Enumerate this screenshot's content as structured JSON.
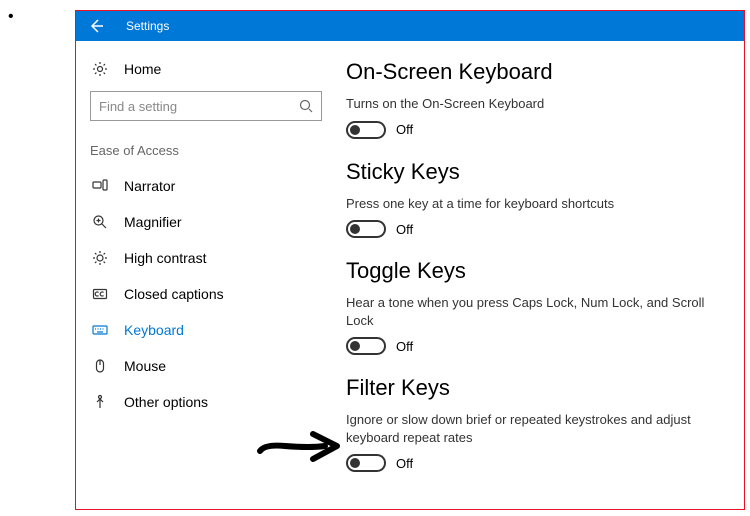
{
  "window": {
    "title": "Settings"
  },
  "sidebar": {
    "home": "Home",
    "search_placeholder": "Find a setting",
    "section_header": "Ease of Access",
    "items": [
      {
        "label": "Narrator"
      },
      {
        "label": "Magnifier"
      },
      {
        "label": "High contrast"
      },
      {
        "label": "Closed captions"
      },
      {
        "label": "Keyboard"
      },
      {
        "label": "Mouse"
      },
      {
        "label": "Other options"
      }
    ]
  },
  "main": {
    "groups": [
      {
        "title": "On-Screen Keyboard",
        "desc": "Turns on the On-Screen Keyboard",
        "state": "Off"
      },
      {
        "title": "Sticky Keys",
        "desc": "Press one key at a time for keyboard shortcuts",
        "state": "Off"
      },
      {
        "title": "Toggle Keys",
        "desc": "Hear a tone when you press Caps Lock, Num Lock, and Scroll Lock",
        "state": "Off"
      },
      {
        "title": "Filter Keys",
        "desc": "Ignore or slow down brief or repeated keystrokes and adjust keyboard repeat rates",
        "state": "Off"
      }
    ]
  }
}
